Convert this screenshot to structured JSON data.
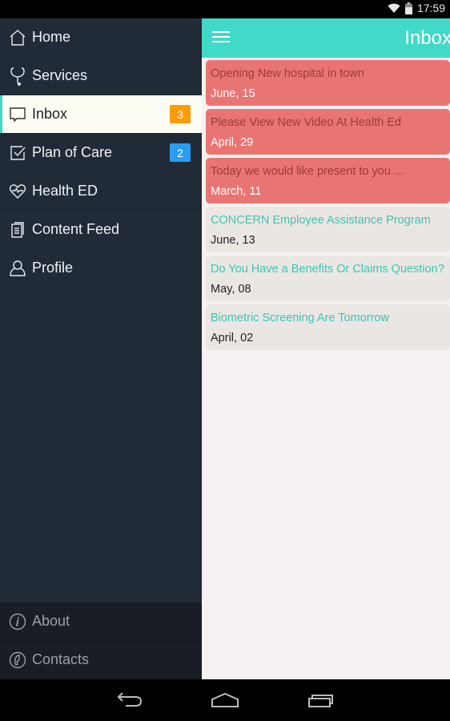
{
  "status_bar": {
    "time": "17:59",
    "icons": [
      "wifi-icon",
      "battery-icon"
    ]
  },
  "drawer": {
    "items": [
      {
        "label": "Home",
        "icon": "home-icon",
        "badge": null,
        "active": false
      },
      {
        "label": "Services",
        "icon": "stethoscope-icon",
        "badge": null,
        "active": false
      },
      {
        "label": "Inbox",
        "icon": "chat-bubble-icon",
        "badge": "3",
        "badge_color": "#ff9a0a",
        "active": true
      },
      {
        "label": "Plan of Care",
        "icon": "checkbox-icon",
        "badge": "2",
        "badge_color": "#2a9cf2",
        "active": false
      },
      {
        "label": "Health ED",
        "icon": "heart-pulse-icon",
        "badge": null,
        "active": false
      },
      {
        "label": "Content Feed",
        "icon": "documents-icon",
        "badge": null,
        "active": false
      },
      {
        "label": "Profile",
        "icon": "user-icon",
        "badge": null,
        "active": false
      }
    ],
    "footer": [
      {
        "label": "About",
        "icon": "info-icon"
      },
      {
        "label": "Contacts",
        "icon": "phone-icon"
      }
    ]
  },
  "app_bar": {
    "title": "Inbox",
    "menu_icon": "hamburger-icon",
    "accent": "#41d9c7"
  },
  "messages": [
    {
      "title": "Opening New hospital in town",
      "date": "June, 15",
      "unread": true
    },
    {
      "title": "Please View New Video At Health Ed",
      "date": "April, 29",
      "unread": true
    },
    {
      "title": "Today we would like present to you ...",
      "date": "March, 11",
      "unread": true
    },
    {
      "title": "CONCERN Employee Assistance Program",
      "date": "June, 13",
      "unread": false
    },
    {
      "title": "Do You Have a Benefits Or Claims Question?",
      "date": "May, 08",
      "unread": false
    },
    {
      "title": "Biometric Screening Are Tomorrow",
      "date": "April, 02",
      "unread": false
    }
  ],
  "system_nav": {
    "buttons": [
      "back-icon",
      "home-icon",
      "recents-icon"
    ]
  }
}
